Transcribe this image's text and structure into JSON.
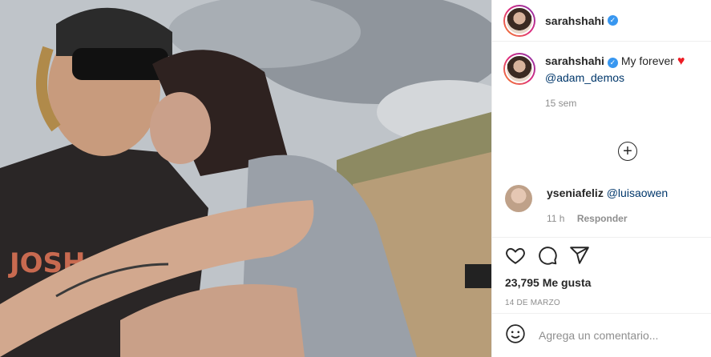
{
  "post": {
    "author": "sarahshahi",
    "caption_text": "My forever",
    "caption_mention": "@adam_demos",
    "time_ago": "15 sem",
    "photo_alt": "selfie of couple hugging outdoors"
  },
  "comments": [
    {
      "username": "yseniafeliz",
      "mention": "@luisaowen",
      "time": "11 h",
      "reply_label": "Responder"
    }
  ],
  "actions": {
    "likes": "23,795 Me gusta",
    "date": "14 DE MARZO"
  },
  "add_comment": {
    "placeholder": "Agrega un comentario..."
  },
  "colors": {
    "accent_link": "#00376b",
    "verified": "#3897f0",
    "heart": "#ed1c24",
    "muted": "#8e8e8e"
  }
}
